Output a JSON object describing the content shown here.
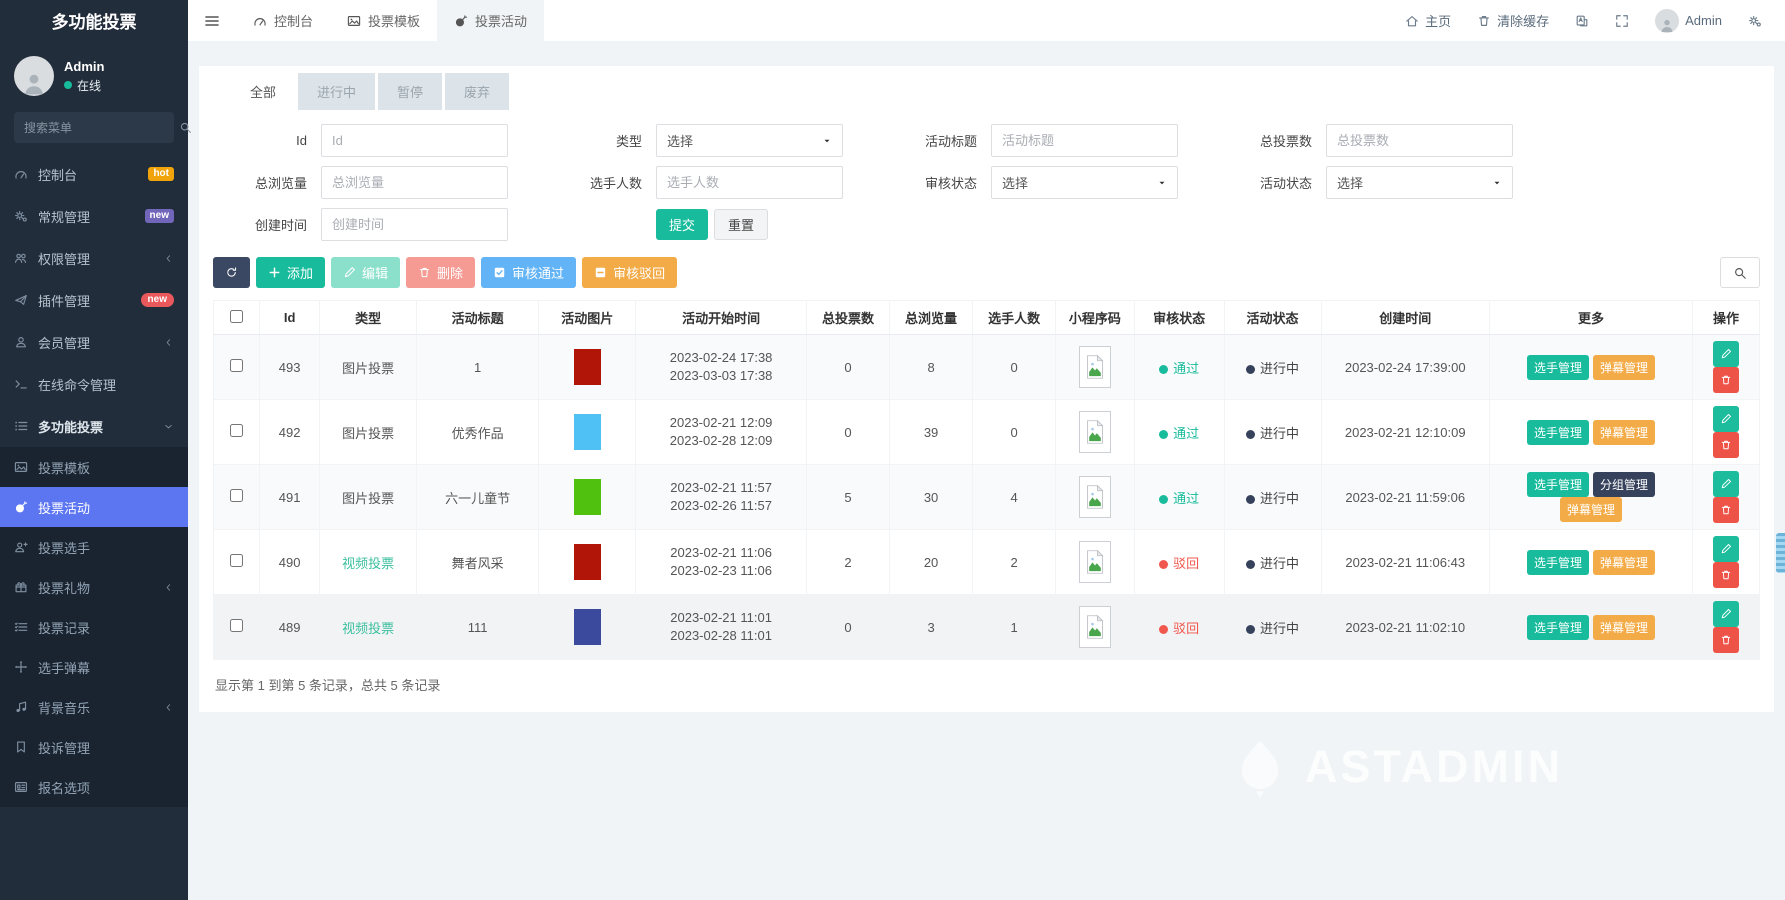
{
  "app": {
    "title": "多功能投票"
  },
  "sidebar": {
    "user": {
      "name": "Admin",
      "status": "在线"
    },
    "search_placeholder": "搜索菜单",
    "items": [
      {
        "label": "控制台",
        "icon": "gauge",
        "badge": {
          "text": "hot",
          "style": "hot"
        }
      },
      {
        "label": "常规管理",
        "icon": "gears",
        "badge": {
          "text": "new",
          "style": "new-purple"
        }
      },
      {
        "label": "权限管理",
        "icon": "users",
        "chevron": "left"
      },
      {
        "label": "插件管理",
        "icon": "rocket",
        "badge": {
          "text": "new",
          "style": "new-red"
        }
      },
      {
        "label": "会员管理",
        "icon": "user",
        "chevron": "left"
      },
      {
        "label": "在线命令管理",
        "icon": "terminal"
      },
      {
        "label": "多功能投票",
        "icon": "list",
        "chevron": "down",
        "bold": true
      }
    ],
    "subitems": [
      {
        "label": "投票模板",
        "icon": "image"
      },
      {
        "label": "投票活动",
        "icon": "bomb",
        "active": true
      },
      {
        "label": "投票选手",
        "icon": "userplus"
      },
      {
        "label": "投票礼物",
        "icon": "gift",
        "chevron": "left"
      },
      {
        "label": "投票记录",
        "icon": "listcheck"
      },
      {
        "label": "选手弹幕",
        "icon": "move"
      },
      {
        "label": "背景音乐",
        "icon": "music",
        "chevron": "left"
      },
      {
        "label": "投诉管理",
        "icon": "bookmark"
      },
      {
        "label": "报名选项",
        "icon": "card"
      }
    ]
  },
  "topbar": {
    "tabs": [
      {
        "label": "控制台",
        "icon": "gauge"
      },
      {
        "label": "投票模板",
        "icon": "image"
      },
      {
        "label": "投票活动",
        "icon": "bomb",
        "active": true
      }
    ],
    "home_label": "主页",
    "clear_cache_label": "清除缓存",
    "user_name": "Admin"
  },
  "filters": {
    "tabs": [
      {
        "label": "全部",
        "active": true
      },
      {
        "label": "进行中"
      },
      {
        "label": "暂停"
      },
      {
        "label": "废弃"
      }
    ],
    "fields": [
      {
        "label": "Id",
        "control": "input",
        "placeholder": "Id"
      },
      {
        "label": "类型",
        "control": "select",
        "value": "选择"
      },
      {
        "label": "活动标题",
        "control": "input",
        "placeholder": "活动标题"
      },
      {
        "label": "总投票数",
        "control": "input",
        "placeholder": "总投票数"
      },
      {
        "label": "总浏览量",
        "control": "input",
        "placeholder": "总浏览量"
      },
      {
        "label": "选手人数",
        "control": "input",
        "placeholder": "选手人数"
      },
      {
        "label": "审核状态",
        "control": "select",
        "value": "选择"
      },
      {
        "label": "活动状态",
        "control": "select",
        "value": "选择"
      },
      {
        "label": "创建时间",
        "control": "input",
        "placeholder": "创建时间"
      }
    ],
    "submit_label": "提交",
    "reset_label": "重置"
  },
  "toolbar": {
    "buttons": [
      {
        "name": "refresh",
        "icon": "refresh",
        "bg": "#3b4863"
      },
      {
        "name": "add",
        "label": "添加",
        "icon": "plus",
        "bg": "#18bc9c"
      },
      {
        "name": "edit",
        "label": "编辑",
        "icon": "pencil",
        "bg": "#8be0cb"
      },
      {
        "name": "delete",
        "label": "删除",
        "icon": "trash",
        "bg": "#f59b94"
      },
      {
        "name": "approve",
        "label": "审核通过",
        "icon": "checksq",
        "bg": "#63b4f6"
      },
      {
        "name": "reject",
        "label": "审核驳回",
        "icon": "minussq",
        "bg": "#f3ab47"
      }
    ]
  },
  "colors": {
    "green": "#18bc9c",
    "orange": "#f3ab47",
    "dark": "#36425c",
    "red": "#f0584d"
  },
  "table": {
    "columns": [
      "",
      "Id",
      "类型",
      "活动标题",
      "活动图片",
      "活动开始时间",
      "总投票数",
      "总浏览量",
      "选手人数",
      "小程序码",
      "审核状态",
      "活动状态",
      "创建时间",
      "更多",
      "操作"
    ],
    "rows": [
      {
        "id": "493",
        "type": "图片投票",
        "type_green": false,
        "title": "1",
        "img": "#b11508",
        "start": "2023-02-24 17:38",
        "end": "2023-03-03 17:38",
        "votes": "0",
        "views": "8",
        "players": "0",
        "review": "通过",
        "review_ok": true,
        "state": "进行中",
        "created": "2023-02-24 17:39:00",
        "more": [
          {
            "label": "选手管理",
            "style": "green"
          },
          {
            "label": "弹幕管理",
            "style": "orange"
          }
        ]
      },
      {
        "id": "492",
        "type": "图片投票",
        "type_green": false,
        "title": "优秀作品",
        "img": "#4fc1f5",
        "start": "2023-02-21 12:09",
        "end": "2023-02-28 12:09",
        "votes": "0",
        "views": "39",
        "players": "0",
        "review": "通过",
        "review_ok": true,
        "state": "进行中",
        "created": "2023-02-21 12:10:09",
        "more": [
          {
            "label": "选手管理",
            "style": "green"
          },
          {
            "label": "弹幕管理",
            "style": "orange"
          }
        ]
      },
      {
        "id": "491",
        "type": "图片投票",
        "type_green": false,
        "title": "六一儿童节",
        "img": "#4fc10e",
        "start": "2023-02-21 11:57",
        "end": "2023-02-26 11:57",
        "votes": "5",
        "views": "30",
        "players": "4",
        "review": "通过",
        "review_ok": true,
        "state": "进行中",
        "created": "2023-02-21 11:59:06",
        "more": [
          {
            "label": "选手管理",
            "style": "green"
          },
          {
            "label": "分组管理",
            "style": "dark"
          },
          {
            "label": "弹幕管理",
            "style": "orange"
          }
        ]
      },
      {
        "id": "490",
        "type": "视频投票",
        "type_green": true,
        "title": "舞者风采",
        "img": "#b11508",
        "start": "2023-02-21 11:06",
        "end": "2023-02-23 11:06",
        "votes": "2",
        "views": "20",
        "players": "2",
        "review": "驳回",
        "review_ok": false,
        "state": "进行中",
        "created": "2023-02-21 11:06:43",
        "more": [
          {
            "label": "选手管理",
            "style": "green"
          },
          {
            "label": "弹幕管理",
            "style": "orange"
          }
        ]
      },
      {
        "id": "489",
        "type": "视频投票",
        "type_green": true,
        "title": "111",
        "img": "#3c4a9e",
        "start": "2023-02-21 11:01",
        "end": "2023-02-28 11:01",
        "votes": "0",
        "views": "3",
        "players": "1",
        "review": "驳回",
        "review_ok": false,
        "state": "进行中",
        "created": "2023-02-21 11:02:10",
        "more": [
          {
            "label": "选手管理",
            "style": "green"
          },
          {
            "label": "弹幕管理",
            "style": "orange"
          }
        ]
      }
    ],
    "summary": "显示第 1 到第 5 条记录，总共 5 条记录"
  },
  "watermark": {
    "text": "ASTADMIN"
  }
}
